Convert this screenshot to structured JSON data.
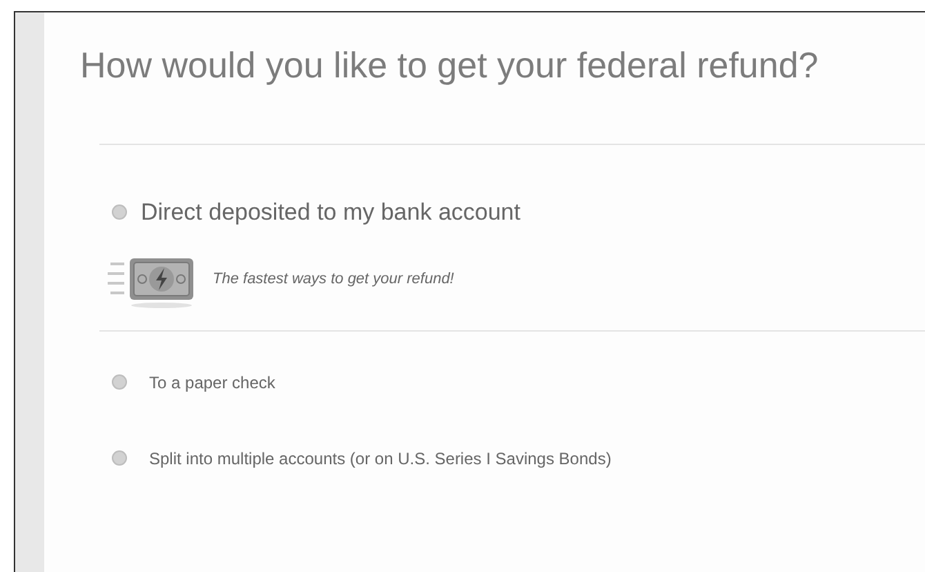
{
  "title": "How would you like to get your federal refund?",
  "primary_options": [
    {
      "label": "Direct deposited to my bank account",
      "selected": false,
      "promo": "The fastest ways to get your refund!"
    }
  ],
  "other_options": [
    {
      "label": "To a paper check",
      "selected": false
    },
    {
      "label": "Split into multiple accounts (or on U.S. Series I Savings Bonds)",
      "selected": false
    }
  ]
}
